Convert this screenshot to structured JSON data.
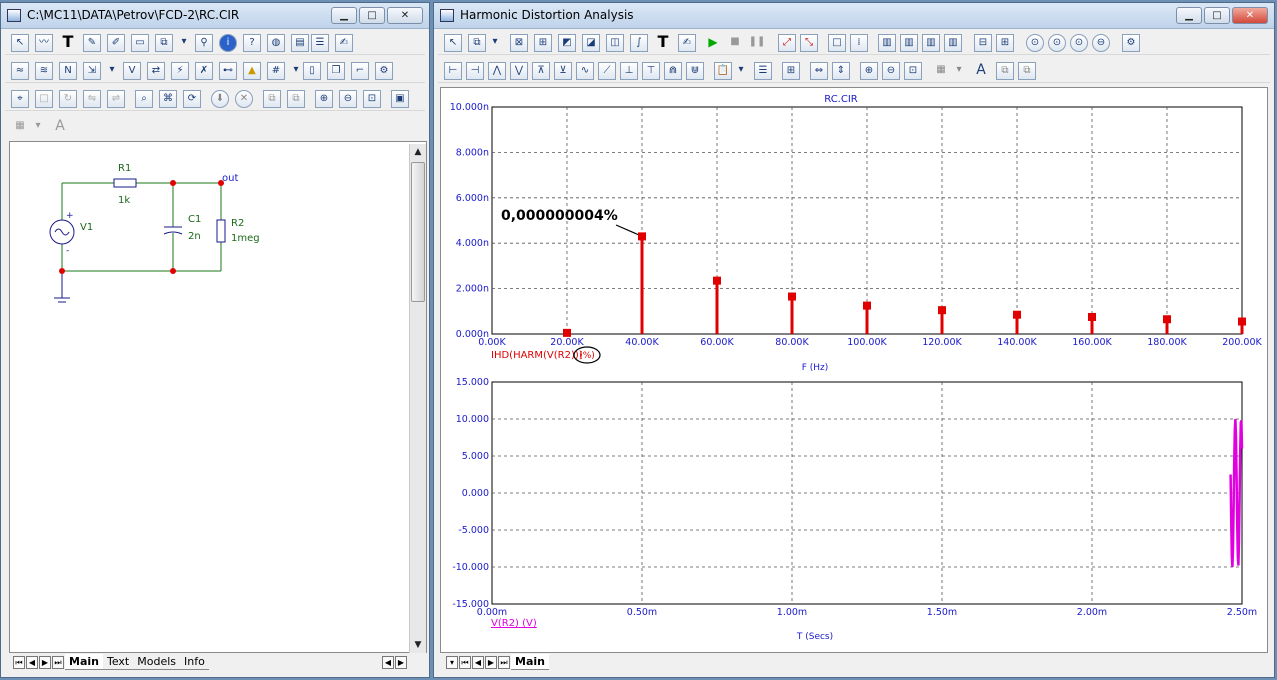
{
  "left_window": {
    "title": "C:\\MC11\\DATA\\Petrov\\FCD-2\\RC.CIR",
    "tabs": [
      "Main",
      "Text",
      "Models",
      "Info"
    ]
  },
  "schematic": {
    "r1_name": "R1",
    "r1_value": "1k",
    "c1_name": "C1",
    "c1_value": "2n",
    "r2_name": "R2",
    "r2_value": "1meg",
    "v1_name": "V1",
    "node_out": "out",
    "plus": "+",
    "minus": "-"
  },
  "right_window": {
    "title": "Harmonic Distortion Analysis",
    "tabs": [
      "Main"
    ]
  },
  "toolbar_text_glyph": "T",
  "font_glyph": "A",
  "chart_data": [
    {
      "type": "bar",
      "title": "RC.CIR",
      "xlabel": "F (Hz)",
      "ylabel": "",
      "series_label": "IHD(HARM(V(R2)))",
      "series_unit": "(%)",
      "x_ticks": [
        "0.00K",
        "20.00K",
        "40.00K",
        "60.00K",
        "80.00K",
        "100.00K",
        "120.00K",
        "140.00K",
        "160.00K",
        "180.00K",
        "200.00K"
      ],
      "y_ticks": [
        "0.000n",
        "2.000n",
        "4.000n",
        "6.000n",
        "8.000n",
        "10.000n"
      ],
      "xlim": [
        0,
        200000
      ],
      "ylim": [
        0,
        10
      ],
      "x": [
        20000,
        40000,
        60000,
        80000,
        100000,
        120000,
        140000,
        160000,
        180000,
        200000
      ],
      "values": [
        0.05,
        4.3,
        2.35,
        1.65,
        1.25,
        1.05,
        0.85,
        0.75,
        0.65,
        0.55
      ],
      "annotation": "0,000000004%",
      "color": "#e00000"
    },
    {
      "type": "line",
      "xlabel": "T (Secs)",
      "series_label": "V(R2) (V)",
      "x_ticks": [
        "0.00m",
        "0.50m",
        "1.00m",
        "1.50m",
        "2.00m",
        "2.50m"
      ],
      "y_ticks": [
        "-15.000",
        "-10.000",
        "-5.000",
        "0.000",
        "5.000",
        "10.000",
        "15.000"
      ],
      "xlim": [
        0,
        2.5
      ],
      "ylim": [
        -15,
        15
      ],
      "x": [
        2.462,
        2.464,
        2.466,
        2.468,
        2.47,
        2.472,
        2.474,
        2.476,
        2.478,
        2.48,
        2.482,
        2.484,
        2.486,
        2.488,
        2.49,
        2.492,
        2.494,
        2.496,
        2.498,
        2.5
      ],
      "y": [
        2.5,
        -3.5,
        -8.5,
        -10.0,
        -7.5,
        -2.0,
        4.0,
        8.5,
        10.0,
        7.5,
        2.0,
        -4.0,
        -8.5,
        -9.8,
        -6.5,
        -0.5,
        5.5,
        9.5,
        9.8,
        6.0
      ],
      "color": "#e000e0"
    }
  ]
}
